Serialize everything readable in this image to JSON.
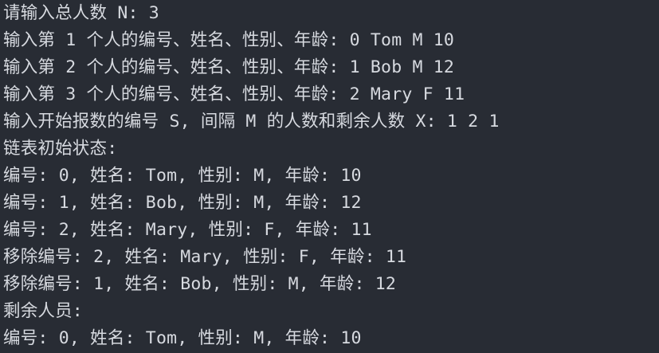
{
  "terminal": {
    "background": "#282c34",
    "foreground": "#d7dae0",
    "lines": [
      "请输入总人数 N: 3",
      "输入第 1 个人的编号、姓名、性别、年龄: 0 Tom M 10",
      "输入第 2 个人的编号、姓名、性别、年龄: 1 Bob M 12",
      "输入第 3 个人的编号、姓名、性别、年龄: 2 Mary F 11",
      "输入开始报数的编号 S, 间隔 M 的人数和剩余人数 X: 1 2 1",
      "链表初始状态:",
      "编号: 0, 姓名: Tom, 性别: M, 年龄: 10",
      "编号: 1, 姓名: Bob, 性别: M, 年龄: 12",
      "编号: 2, 姓名: Mary, 性别: F, 年龄: 11",
      "移除编号: 2, 姓名: Mary, 性别: F, 年龄: 11",
      "移除编号: 1, 姓名: Bob, 性别: M, 年龄: 12",
      "剩余人员:",
      "编号: 0, 姓名: Tom, 性别: M, 年龄: 10"
    ]
  }
}
